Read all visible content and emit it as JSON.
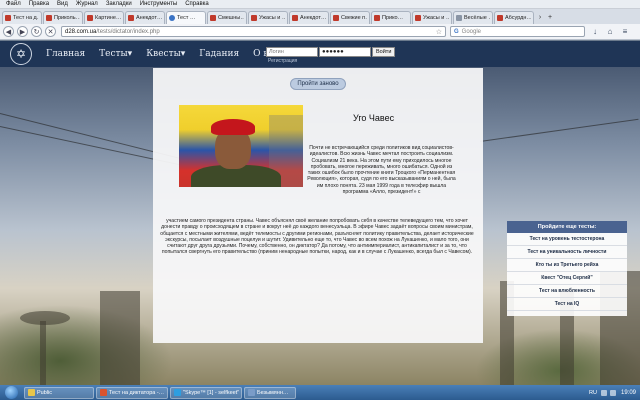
{
  "menubar": {
    "items": [
      "Файл",
      "Правка",
      "Вид",
      "Журнал",
      "Закладки",
      "Инструменты",
      "Справка"
    ]
  },
  "tabs": [
    {
      "label": "Тест на д…",
      "active": false
    },
    {
      "label": "Приколь…",
      "active": false
    },
    {
      "label": "Картине…",
      "active": false
    },
    {
      "label": "Анекдот…",
      "active": false
    },
    {
      "label": "Тест …",
      "active": true
    },
    {
      "label": "Смешны…",
      "active": false
    },
    {
      "label": "Ужасы и …",
      "active": false
    },
    {
      "label": "Анекдот…",
      "active": false
    },
    {
      "label": "Свежие п…",
      "active": false
    },
    {
      "label": "Прико…",
      "active": false
    },
    {
      "label": "Ужасы и …",
      "active": false
    },
    {
      "label": "Весёлые …",
      "active": false
    },
    {
      "label": "Абсурдн…",
      "active": false
    }
  ],
  "navbar": {
    "url_host": "d28.com.ua",
    "url_path": "/tests/dictator/index.php",
    "search_placeholder": "Google"
  },
  "site": {
    "nav": [
      "Главная",
      "Тесты▾",
      "Квесты▾",
      "Гадания",
      "О нас"
    ],
    "login_placeholder": "Логин",
    "password_value": "●●●●●●",
    "login_button": "Войти",
    "register_link": "Регистрация"
  },
  "content": {
    "retry_button": "Пройти заново",
    "title": "Уго Чавес",
    "text_right": "Почти не встречающийся среди политиков вид социалистов-идеалистов. Всю жизнь Чавес мечтал построить социализм. Социализм 21 века. На этом пути ему приходилось многое пробовать, многое переживать, много ошибаться. Одной из таких ошибок было прочтение книги Троцкого «Перманентная Революция», которая, судя по его высказываниям о ней, была им плохо понята. 23 мая 1999 года в телеэфир вышла программа «Алло, президент!» с",
    "text_full": "участием самого президента страны. Чавес объяснял своё желание попробовать себя в качестве телеведущего тем, что хочет донести правду о происходящем в стране и вокруг неё до каждого венесуэльца. В эфире Чавес задаёт вопросы своим министрам, общается с местными жителями, ведёт телемосты с другими регионами, разъясняет политику правительства, делает исторические экскурсы, посылает воздушные поцелуи и шутит. Удивительно еще то, что Чавес во всем похож на Лукашенко, и мало того, они считают друг друга друзьями. Почему, собственно, он диктатор? Да потому, что антиимпериалист, антикапиталист и за то, что попытался свергнуть его правительство (приним ненародные попытки, народ, как и в случае с Лукашенко, всегда был с Чавесом)."
  },
  "side": {
    "header": "Пройдите еще тесты:",
    "items": [
      "Тест на уровень тестостерона",
      "Тест на уникальность личности",
      "Кто ты из Третьего рейха",
      "Квест \"Отец Сергий\"",
      "Тест на влюбленность",
      "Тест на IQ"
    ]
  },
  "taskbar": {
    "items": [
      {
        "label": "Public",
        "color": "#e8c64a"
      },
      {
        "label": "Тест на диктатора -…",
        "color": "#d9532e"
      },
      {
        "label": "\"Skype™ [1] - selfkeet\"",
        "color": "#2e9ee0"
      },
      {
        "label": "Безымянн…",
        "color": "#7a9cc8"
      }
    ],
    "lang": "RU",
    "clock": "19:09"
  }
}
